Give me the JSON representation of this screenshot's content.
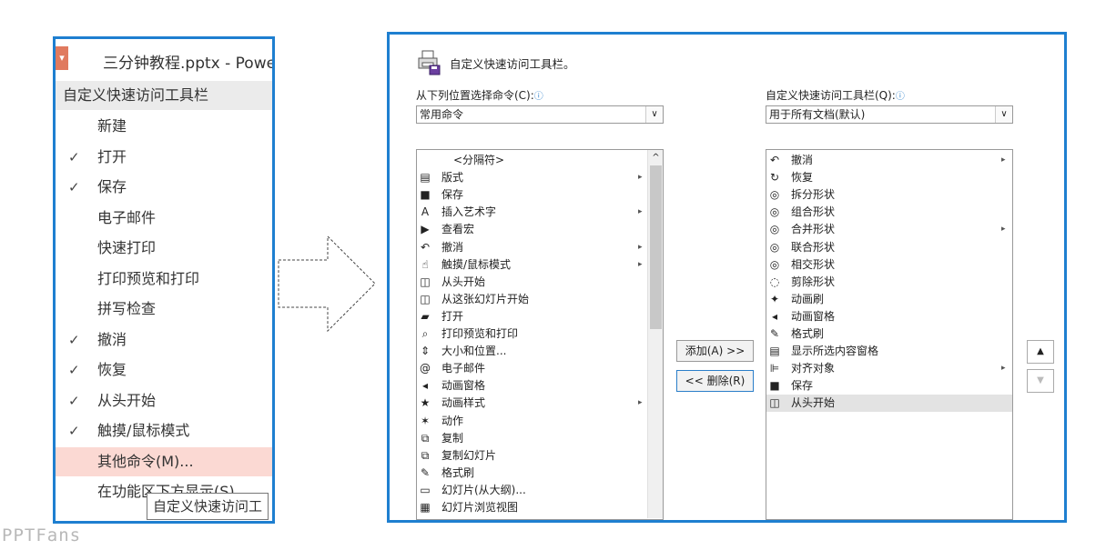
{
  "menu": {
    "window_title": "三分钟教程.pptx - Powe",
    "header": "自定义快速访问工具栏",
    "items": [
      {
        "label": "新建",
        "checked": false
      },
      {
        "label": "打开",
        "checked": true
      },
      {
        "label": "保存",
        "checked": true
      },
      {
        "label": "电子邮件",
        "checked": false
      },
      {
        "label": "快速打印",
        "checked": false
      },
      {
        "label": "打印预览和打印",
        "checked": false
      },
      {
        "label": "拼写检查",
        "checked": false
      },
      {
        "label": "撤消",
        "checked": true
      },
      {
        "label": "恢复",
        "checked": true
      },
      {
        "label": "从头开始",
        "checked": true
      },
      {
        "label": "触摸/鼠标模式",
        "checked": true
      },
      {
        "label": "其他命令(M)...",
        "checked": false,
        "highlighted": true
      },
      {
        "label": "在功能区下方显示(S)",
        "checked": false
      }
    ],
    "check_glyph": "✓",
    "tooltip": "自定义快速访问工"
  },
  "dialog": {
    "title": "自定义快速访问工具栏。",
    "left": {
      "label": "从下列位置选择命令(C):",
      "select_value": "常用命令",
      "items": [
        {
          "label": "<分隔符>",
          "icon": "",
          "has_submenu": false
        },
        {
          "label": "版式",
          "icon": "▤",
          "has_submenu": true
        },
        {
          "label": "保存",
          "icon": "■",
          "has_submenu": false
        },
        {
          "label": "插入艺术字",
          "icon": "A",
          "has_submenu": true
        },
        {
          "label": "查看宏",
          "icon": "▶",
          "has_submenu": false
        },
        {
          "label": "撤消",
          "icon": "↶",
          "has_submenu": true
        },
        {
          "label": "触摸/鼠标模式",
          "icon": "☝",
          "has_submenu": true
        },
        {
          "label": "从头开始",
          "icon": "◫",
          "has_submenu": false
        },
        {
          "label": "从这张幻灯片开始",
          "icon": "◫",
          "has_submenu": false
        },
        {
          "label": "打开",
          "icon": "▰",
          "has_submenu": false
        },
        {
          "label": "打印预览和打印",
          "icon": "⌕",
          "has_submenu": false
        },
        {
          "label": "大小和位置...",
          "icon": "⇕",
          "has_submenu": false
        },
        {
          "label": "电子邮件",
          "icon": "@",
          "has_submenu": false
        },
        {
          "label": "动画窗格",
          "icon": "◂",
          "has_submenu": false
        },
        {
          "label": "动画样式",
          "icon": "★",
          "has_submenu": true
        },
        {
          "label": "动作",
          "icon": "✶",
          "has_submenu": false
        },
        {
          "label": "复制",
          "icon": "⧉",
          "has_submenu": false
        },
        {
          "label": "复制幻灯片",
          "icon": "⧉",
          "has_submenu": false
        },
        {
          "label": "格式刷",
          "icon": "✎",
          "has_submenu": false
        },
        {
          "label": "幻灯片(从大纲)...",
          "icon": "▭",
          "has_submenu": false
        },
        {
          "label": "幻灯片浏览视图",
          "icon": "▦",
          "has_submenu": false
        }
      ]
    },
    "right": {
      "label": "自定义快速访问工具栏(Q):",
      "select_value": "用于所有文档(默认)",
      "items": [
        {
          "label": "撤消",
          "icon": "↶",
          "has_submenu": true
        },
        {
          "label": "恢复",
          "icon": "↻",
          "has_submenu": false
        },
        {
          "label": "拆分形状",
          "icon": "◎",
          "has_submenu": false
        },
        {
          "label": "组合形状",
          "icon": "◎",
          "has_submenu": false
        },
        {
          "label": "合并形状",
          "icon": "◎",
          "has_submenu": true
        },
        {
          "label": "联合形状",
          "icon": "◎",
          "has_submenu": false
        },
        {
          "label": "相交形状",
          "icon": "◎",
          "has_submenu": false
        },
        {
          "label": "剪除形状",
          "icon": "◌",
          "has_submenu": false
        },
        {
          "label": "动画刷",
          "icon": "✦",
          "has_submenu": false
        },
        {
          "label": "动画窗格",
          "icon": "◂",
          "has_submenu": false
        },
        {
          "label": "格式刷",
          "icon": "✎",
          "has_submenu": false
        },
        {
          "label": "显示所选内容窗格",
          "icon": "▤",
          "has_submenu": false
        },
        {
          "label": "对齐对象",
          "icon": "⊫",
          "has_submenu": true
        },
        {
          "label": "保存",
          "icon": "■",
          "has_submenu": false
        },
        {
          "label": "从头开始",
          "icon": "◫",
          "has_submenu": false,
          "selected": true
        }
      ]
    },
    "add_button": "添加(A) >>",
    "remove_button": "<< 删除(R)",
    "move_up_glyph": "▲",
    "move_down_glyph": "▼",
    "info_glyph": "ⓘ",
    "dropdown_glyph": "∨",
    "submenu_glyph": "▸"
  },
  "watermark": "PPTFans",
  "colors": {
    "panel_border": "#1e7fd0",
    "menu_highlight": "#fbd9d3",
    "list_selected": "#e3e3e3"
  }
}
